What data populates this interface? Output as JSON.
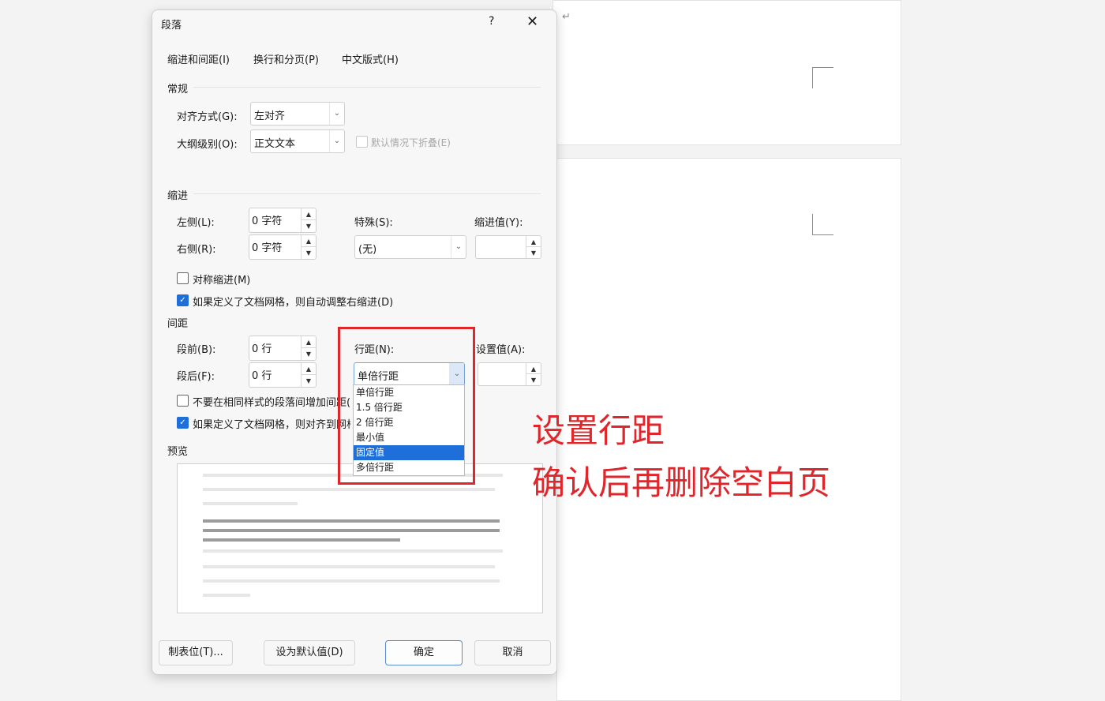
{
  "document": {
    "paragraph_mark": "↵"
  },
  "dialog": {
    "title": "段落",
    "help": "?",
    "close": "✕",
    "tabs": [
      "缩进和间距(I)",
      "换行和分页(P)",
      "中文版式(H)"
    ],
    "general": {
      "section": "常规",
      "alignment_label": "对齐方式(G):",
      "alignment_value": "左对齐",
      "outline_label": "大纲级别(O):",
      "outline_value": "正文文本",
      "collapse_label": "默认情况下折叠(E)"
    },
    "indent": {
      "section": "缩进",
      "left_label": "左侧(L):",
      "left_value": "0 字符",
      "right_label": "右侧(R):",
      "right_value": "0 字符",
      "special_label": "特殊(S):",
      "special_value": "(无)",
      "indent_by_label": "缩进值(Y):",
      "indent_by_value": "",
      "mirror_label": "对称缩进(M)",
      "mirror_checked": false,
      "auto_adjust_label": "如果定义了文档网格，则自动调整右缩进(D)",
      "auto_adjust_checked": true
    },
    "spacing": {
      "section": "间距",
      "before_label": "段前(B):",
      "before_value": "0 行",
      "after_label": "段后(F):",
      "after_value": "0 行",
      "line_spacing_label": "行距(N):",
      "line_spacing_value": "单倍行距",
      "at_label": "设置值(A):",
      "at_value": "",
      "no_space_label": "不要在相同样式的段落间增加间距(C)",
      "no_space_checked": false,
      "snap_grid_label": "如果定义了文档网格，则对齐到网格(W)",
      "snap_grid_checked": true,
      "line_spacing_options": [
        "单倍行距",
        "1.5 倍行距",
        "2 倍行距",
        "最小值",
        "固定值",
        "多倍行距"
      ],
      "highlighted_option": "固定值"
    },
    "preview": {
      "section": "预览"
    },
    "buttons": {
      "tabs": "制表位(T)...",
      "set_default": "设为默认值(D)",
      "ok": "确定",
      "cancel": "取消"
    }
  },
  "annotation": {
    "line1": "设置行距",
    "line2": "确认后再删除空白页",
    "color": "#e0252b"
  }
}
